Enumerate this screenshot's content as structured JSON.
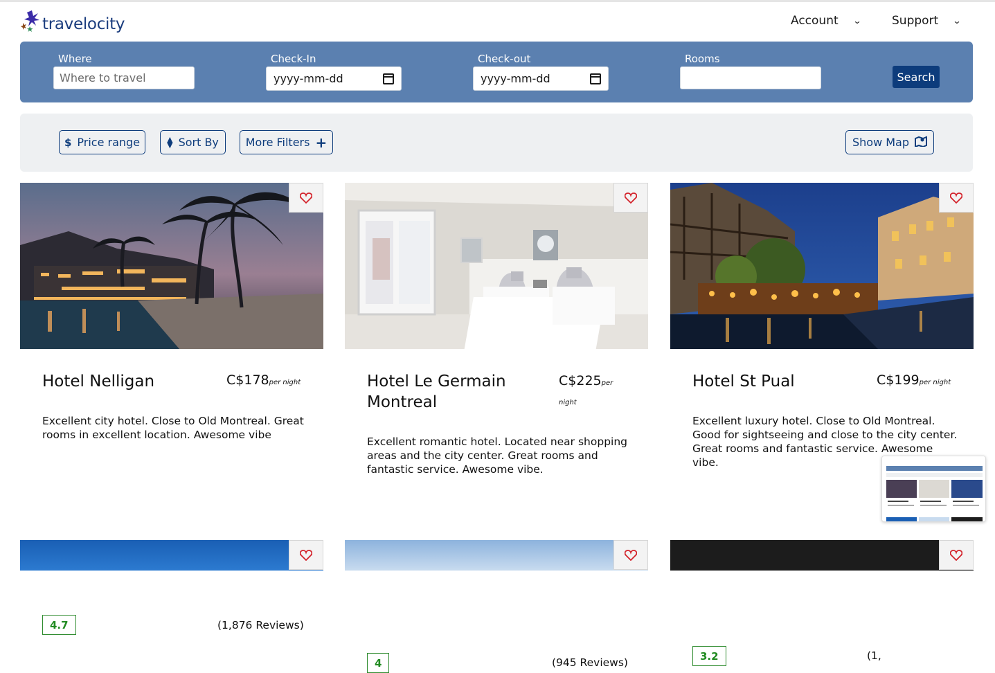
{
  "brand": {
    "name": "travelocity"
  },
  "nav": {
    "account": "Account",
    "support": "Support"
  },
  "search": {
    "where_label": "Where",
    "where_placeholder": "Where to travel",
    "checkin_label": "Check-In",
    "checkin_placeholder": "yyyy-mm-dd",
    "checkout_label": "Check-out",
    "checkout_placeholder": "yyyy-mm-dd",
    "rooms_label": "Rooms",
    "button": "Search"
  },
  "filters": {
    "price_range": "Price range",
    "sort_by": "Sort By",
    "more_filters": "More Filters",
    "show_map": "Show Map"
  },
  "hotels": [
    {
      "name": "Hotel Nelligan",
      "price": "C$178",
      "per": "per night",
      "desc": "Excellent city hotel. Close to Old Montreal. Great rooms in excellent location. Awesome vibe",
      "rating": "4.7",
      "reviews": "(1,876 Reviews)"
    },
    {
      "name": "Hotel Le Germain Montreal",
      "price": "C$225",
      "per": "per night",
      "desc": "Excellent romantic hotel. Located near shopping areas and the city center. Great rooms and fantastic service. Awesome vibe.",
      "rating": "4",
      "reviews": "(945 Reviews)"
    },
    {
      "name": "Hotel St Pual",
      "price": "C$199",
      "per": "per night",
      "desc": "Excellent luxury hotel. Close to Old Montreal. Good for sightseeing and close to the city center. Great rooms and fantastic service. Awesome vibe.",
      "rating": "3.2",
      "reviews": "(1,"
    }
  ],
  "colors": {
    "brand_blue": "#0d3c7c",
    "search_bg": "#5b80b0",
    "rating_green": "#228b22"
  }
}
